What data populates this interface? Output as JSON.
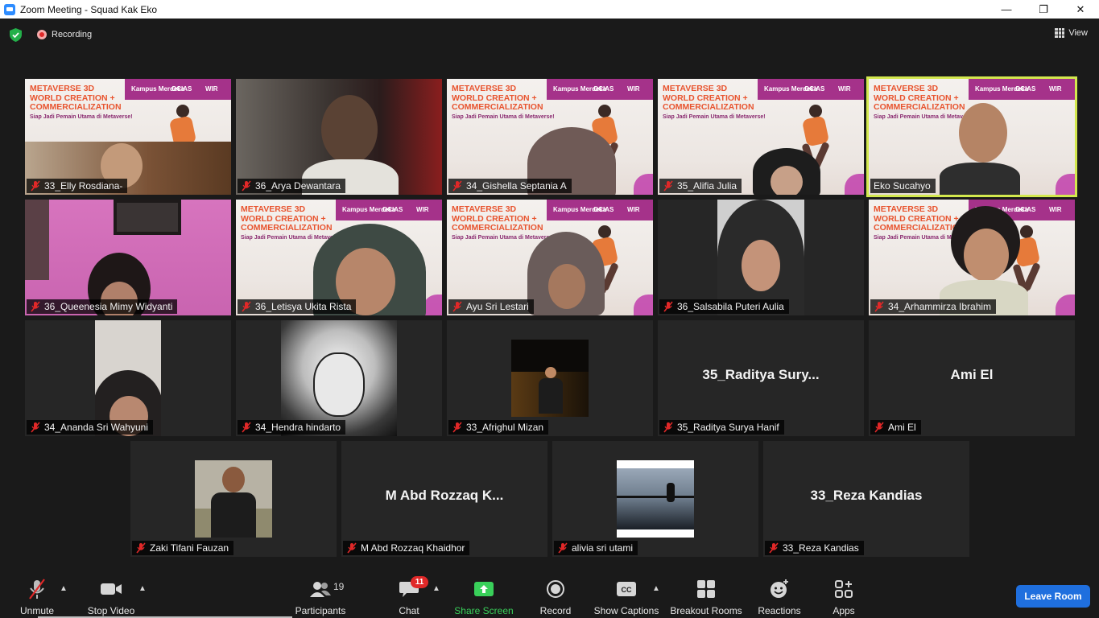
{
  "window": {
    "title": "Zoom Meeting - Squad Kak Eko",
    "controls": [
      "—",
      "❐",
      "✕"
    ]
  },
  "topbar": {
    "recording_label": "Recording",
    "view_label": "View"
  },
  "participants": [
    {
      "name": "33_Elly Rosdiana-"
    },
    {
      "name": "36_Arya Dewantara"
    },
    {
      "name": "34_Gishella Septania A"
    },
    {
      "name": "35_Alifia Julia"
    },
    {
      "name": "Eko Sucahyo"
    },
    {
      "name": "36_Queenesia Mimy Widyanti"
    },
    {
      "name": "36_Letisya Ukita Rista"
    },
    {
      "name": "Ayu Sri Lestari"
    },
    {
      "name": "36_Salsabila Puteri Aulia"
    },
    {
      "name": "34_Arhammirza Ibrahim"
    },
    {
      "name": "34_Ananda Sri Wahyuni"
    },
    {
      "name": "34_Hendra hindarto"
    },
    {
      "name": "33_Afrighul Mizan"
    },
    {
      "name": "35_Raditya Surya Hanif",
      "display": "35_Raditya  Sury..."
    },
    {
      "name": "Ami El",
      "display": "Ami El"
    },
    {
      "name": "Zaki Tifani Fauzan"
    },
    {
      "name": "M Abd Rozzaq Khaidhor",
      "display": "M Abd Rozzaq K..."
    },
    {
      "name": "alivia sri utami"
    },
    {
      "name": "33_Reza Kandias",
      "display": "33_Reza Kandias"
    }
  ],
  "slide": {
    "title_line1": "METAVERSE 3D",
    "title_line2": "WORLD CREATION +",
    "title_line3": "COMMERCIALIZATION",
    "subtitle": "Siap Jadi Pemain Utama di Metaverse!",
    "logo1": "Kampus Merdeka",
    "logo2": "OCIAS",
    "logo3": "WIR"
  },
  "toolbar": {
    "unmute": "Unmute",
    "stop_video": "Stop Video",
    "participants": "Participants",
    "participants_count": "19",
    "chat": "Chat",
    "chat_badge": "11",
    "share_screen": "Share Screen",
    "record": "Record",
    "show_captions": "Show Captions",
    "breakout_rooms": "Breakout Rooms",
    "reactions": "Reactions",
    "apps": "Apps",
    "leave_room": "Leave Room"
  },
  "colors": {
    "share_green": "#39d05a",
    "leave_blue": "#1f6fde",
    "active_speaker": "#d3e84e",
    "mute_red": "#e02828"
  }
}
